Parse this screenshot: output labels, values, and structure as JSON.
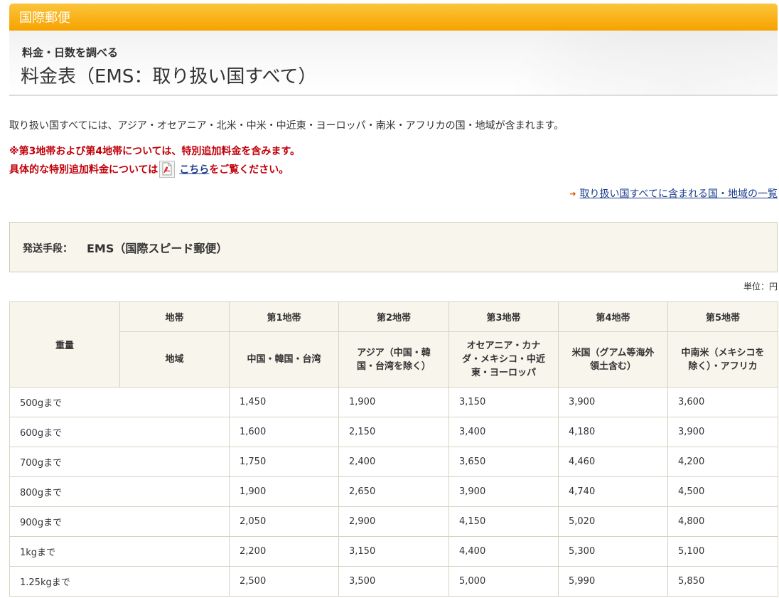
{
  "header": {
    "title": "国際郵便"
  },
  "subheader": {
    "small": "料金・日数を調べる",
    "big": "料金表（EMS：取り扱い国すべて）"
  },
  "description": "取り扱い国すべてには、アジア・オセアニア・北米・中米・中近東・ヨーロッパ・南米・アフリカの国・地域が含まれます。",
  "notes": {
    "line1": "※第3地帯および第4地帯については、特別追加料金を含みます。",
    "line2_prefix": "具体的な特別追加料金については",
    "line2_link": "こちら",
    "line2_suffix": "をご覧ください。"
  },
  "country_list_link": "取り扱い国すべてに含まれる国・地域の一覧",
  "method": {
    "label": "発送手段：",
    "value": "EMS（国際スピード郵便）"
  },
  "unit_label": "単位：円",
  "table": {
    "weight_header": "重量",
    "zone_header": "地帯",
    "region_header": "地域",
    "zones": [
      "第1地帯",
      "第2地帯",
      "第3地帯",
      "第4地帯",
      "第5地帯"
    ],
    "regions": [
      "中国・韓国・台湾",
      "アジア（中国・韓国・台湾を除く）",
      "オセアニア・カナダ・メキシコ・中近東・ヨーロッパ",
      "米国（グアム等海外領土含む）",
      "中南米（メキシコを除く）・アフリカ"
    ],
    "rows": [
      {
        "weight": "500gまで",
        "prices": [
          "1,450",
          "1,900",
          "3,150",
          "3,900",
          "3,600"
        ]
      },
      {
        "weight": "600gまで",
        "prices": [
          "1,600",
          "2,150",
          "3,400",
          "4,180",
          "3,900"
        ]
      },
      {
        "weight": "700gまで",
        "prices": [
          "1,750",
          "2,400",
          "3,650",
          "4,460",
          "4,200"
        ]
      },
      {
        "weight": "800gまで",
        "prices": [
          "1,900",
          "2,650",
          "3,900",
          "4,740",
          "4,500"
        ]
      },
      {
        "weight": "900gまで",
        "prices": [
          "2,050",
          "2,900",
          "4,150",
          "5,020",
          "4,800"
        ]
      },
      {
        "weight": "1kgまで",
        "prices": [
          "2,200",
          "3,150",
          "4,400",
          "5,300",
          "5,100"
        ]
      },
      {
        "weight": "1.25kgまで",
        "prices": [
          "2,500",
          "3,500",
          "5,000",
          "5,990",
          "5,850"
        ]
      }
    ]
  },
  "icons": {
    "pdf": "pdf-icon",
    "arrow": "arrow-right-icon"
  },
  "colors": {
    "header_orange": "#f9b21a",
    "note_red": "#c0000a",
    "link_blue": "#1a3c8c",
    "table_header_bg": "#f7f5ec"
  }
}
